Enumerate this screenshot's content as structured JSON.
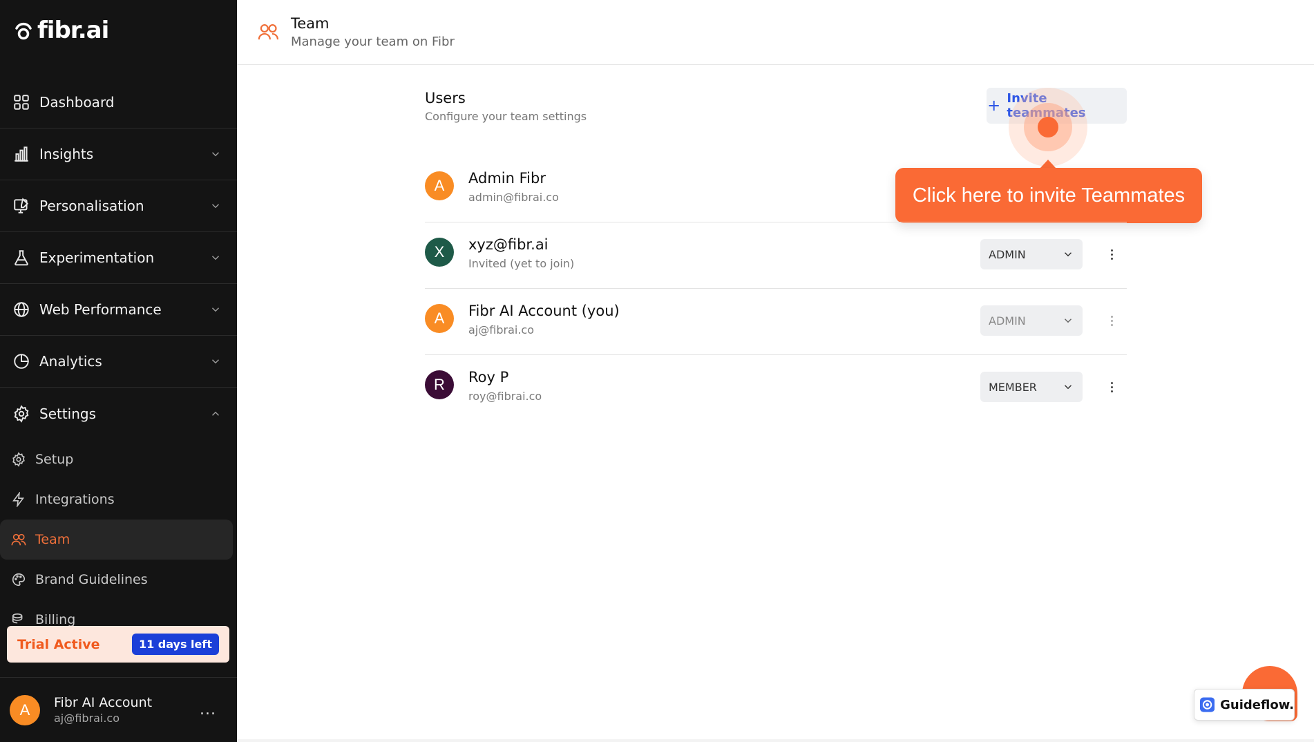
{
  "brand": {
    "name": "fibr.ai",
    "accent": "#fa6a35"
  },
  "sidebar": {
    "items": [
      {
        "label": "Dashboard",
        "icon": "grid-icon",
        "expandable": false
      },
      {
        "label": "Insights",
        "icon": "bar-chart-icon",
        "expandable": true
      },
      {
        "label": "Personalisation",
        "icon": "edit-screen-icon",
        "expandable": true
      },
      {
        "label": "Experimentation",
        "icon": "flask-icon",
        "expandable": true
      },
      {
        "label": "Web Performance",
        "icon": "globe-icon",
        "expandable": true
      },
      {
        "label": "Analytics",
        "icon": "pie-chart-icon",
        "expandable": true
      },
      {
        "label": "Settings",
        "icon": "gear-icon",
        "expandable": true,
        "expanded": true
      }
    ],
    "settings_sub": [
      {
        "label": "Setup",
        "icon": "gear-icon"
      },
      {
        "label": "Integrations",
        "icon": "bolt-icon"
      },
      {
        "label": "Team",
        "icon": "users-icon",
        "active": true
      },
      {
        "label": "Brand Guidelines",
        "icon": "palette-icon"
      },
      {
        "label": "Billing",
        "icon": "coins-icon"
      }
    ],
    "trial": {
      "label": "Trial Active",
      "badge": "11 days left"
    },
    "account": {
      "initial": "A",
      "name": "Fibr AI Account",
      "email": "aj@fibrai.co",
      "more": "..."
    }
  },
  "header": {
    "title": "Team",
    "subtitle": "Manage your team on Fibr"
  },
  "users_section": {
    "title": "Users",
    "subtitle": "Configure your team settings",
    "invite_label": "Invite teammates",
    "tooltip": "Click here to invite Teammates"
  },
  "users": [
    {
      "initial": "A",
      "name": "Admin Fibr",
      "email": "admin@fibrai.co",
      "role": "",
      "avatar_color": "#f98c24"
    },
    {
      "initial": "X",
      "name": "xyz@fibr.ai",
      "email": "Invited (yet to join)",
      "role": "ADMIN",
      "avatar_color": "#1e5a48"
    },
    {
      "initial": "A",
      "name": "Fibr AI Account (you)",
      "email": "aj@fibrai.co",
      "role": "ADMIN",
      "avatar_color": "#f98c24"
    },
    {
      "initial": "R",
      "name": "Roy P",
      "email": "roy@fibrai.co",
      "role": "MEMBER",
      "avatar_color": "#3b0c36"
    }
  ],
  "guideflow": {
    "label": "Guideflow."
  }
}
